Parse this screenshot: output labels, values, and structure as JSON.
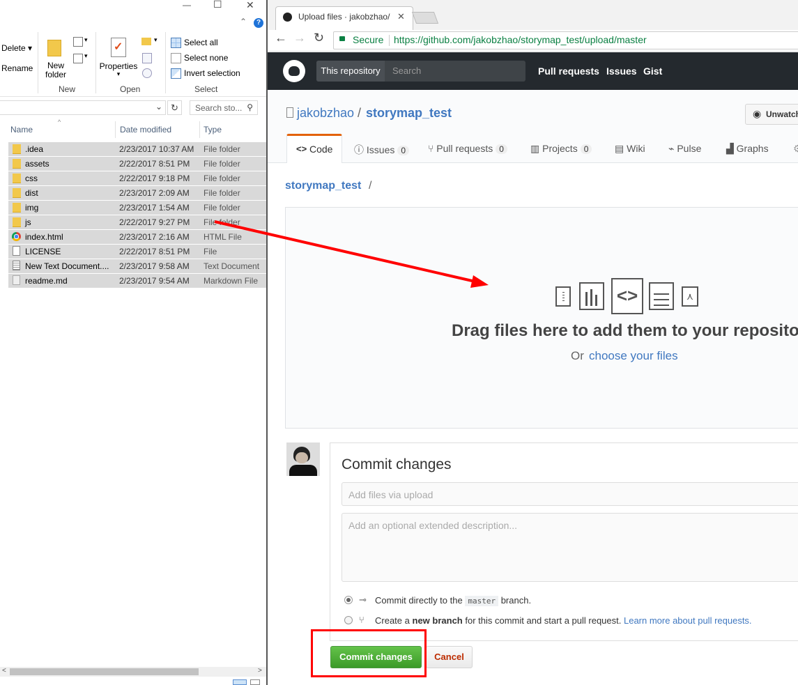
{
  "explorer": {
    "window_controls": {
      "minimize": "—",
      "maximize": "☐",
      "close": "✕",
      "help": "?"
    },
    "ribbon": {
      "delete_label": "Delete",
      "rename_label": "Rename",
      "new_folder_label_1": "New",
      "new_folder_label_2": "folder",
      "new_group": "New",
      "properties_label": "Properties",
      "open_group": "Open",
      "select_all": "Select all",
      "select_none": "Select none",
      "invert_selection": "Invert selection",
      "select_group": "Select"
    },
    "search_placeholder": "Search sto...",
    "columns": {
      "name": "Name",
      "date": "Date modified",
      "type": "Type"
    },
    "files": [
      {
        "name": ".idea",
        "date": "2/23/2017 10:37 AM",
        "type": "File folder",
        "icon": "folder-icon"
      },
      {
        "name": "assets",
        "date": "2/22/2017 8:51 PM",
        "type": "File folder",
        "icon": "folder-icon"
      },
      {
        "name": "css",
        "date": "2/22/2017 9:18 PM",
        "type": "File folder",
        "icon": "folder-icon"
      },
      {
        "name": "dist",
        "date": "2/23/2017 2:09 AM",
        "type": "File folder",
        "icon": "folder-icon"
      },
      {
        "name": "img",
        "date": "2/23/2017 1:54 AM",
        "type": "File folder",
        "icon": "folder-icon"
      },
      {
        "name": "js",
        "date": "2/22/2017 9:27 PM",
        "type": "File folder",
        "icon": "folder-icon"
      },
      {
        "name": "index.html",
        "date": "2/23/2017 2:16 AM",
        "type": "HTML File",
        "icon": "chrome-icon"
      },
      {
        "name": "LICENSE",
        "date": "2/22/2017 8:51 PM",
        "type": "File",
        "icon": "blank-file-icon"
      },
      {
        "name": "New Text Document....",
        "date": "2/23/2017 9:58 AM",
        "type": "Text Document",
        "icon": "text-file-icon"
      },
      {
        "name": "readme.md",
        "date": "2/23/2017 9:54 AM",
        "type": "Markdown File",
        "icon": "markdown-file-icon"
      }
    ]
  },
  "browser": {
    "tab_title": "Upload files · jakobzhao/",
    "secure_label": "Secure",
    "url": "https://github.com/jakobzhao/storymap_test/upload/master",
    "github": {
      "scope_label": "This repository",
      "search_placeholder": "Search",
      "nav": [
        "Pull requests",
        "Issues",
        "Gist"
      ],
      "owner": "jakobzhao",
      "separator": "/",
      "repo": "storymap_test",
      "unwatch_label": "Unwatch",
      "tabs": [
        {
          "label": "Code",
          "count": ""
        },
        {
          "label": "Issues",
          "count": "0"
        },
        {
          "label": "Pull requests",
          "count": "0"
        },
        {
          "label": "Projects",
          "count": "0"
        },
        {
          "label": "Wiki",
          "count": ""
        },
        {
          "label": "Pulse",
          "count": ""
        },
        {
          "label": "Graphs",
          "count": ""
        }
      ],
      "path_repo": "storymap_test",
      "path_sep": "/",
      "drop_title": "Drag files here to add them to your repository",
      "drop_or": "Or",
      "drop_choose": "choose your files",
      "commit_title": "Commit changes",
      "summary_placeholder": "Add files via upload",
      "description_placeholder": "Add an optional extended description...",
      "option_direct_pre": "Commit directly to the",
      "option_direct_branch": "master",
      "option_direct_post": "branch.",
      "option_new_pre": "Create a",
      "option_new_bold": "new branch",
      "option_new_post": "for this commit and start a pull request.",
      "option_new_link": "Learn more about pull requests.",
      "commit_button": "Commit changes",
      "cancel_button": "Cancel"
    }
  },
  "colors": {
    "github_header": "#24292e",
    "link_blue": "#4078c0",
    "commit_green": "#55a532",
    "annotation_red": "#ff0000",
    "selection_gray": "#d9d9d9"
  }
}
